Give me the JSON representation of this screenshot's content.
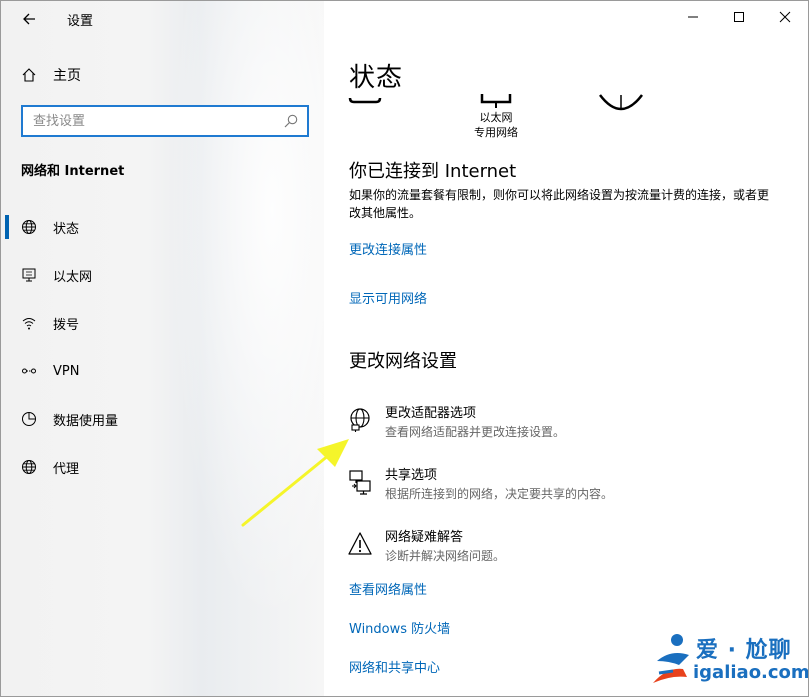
{
  "window": {
    "title": "设置"
  },
  "sidebar": {
    "home_label": "主页",
    "search_placeholder": "查找设置",
    "section_title": "网络和 Internet",
    "items": [
      {
        "label": "状态",
        "icon": "globe-icon",
        "active": true
      },
      {
        "label": "以太网",
        "icon": "ethernet-icon"
      },
      {
        "label": "拨号",
        "icon": "dialup-icon"
      },
      {
        "label": "VPN",
        "icon": "vpn-icon"
      },
      {
        "label": "数据使用量",
        "icon": "data-usage-icon"
      },
      {
        "label": "代理",
        "icon": "globe-icon"
      }
    ]
  },
  "main": {
    "title": "状态",
    "diagram": {
      "network_name": "以太网",
      "network_type": "专用网络"
    },
    "connected_heading": "你已连接到 Internet",
    "connected_text": "如果你的流量套餐有限制，则你可以将此网络设置为按流量计费的连接，或者更改其他属性。",
    "link_change_props": "更改连接属性",
    "link_show_networks": "显示可用网络",
    "change_heading": "更改网络设置",
    "options": [
      {
        "title": "更改适配器选项",
        "desc": "查看网络适配器并更改连接设置。",
        "icon": "adapter-globe-icon"
      },
      {
        "title": "共享选项",
        "desc": "根据所连接到的网络，决定要共享的内容。",
        "icon": "sharing-icon"
      },
      {
        "title": "网络疑难解答",
        "desc": "诊断并解决网络问题。",
        "icon": "warning-icon"
      }
    ],
    "link_view_props": "查看网络属性",
    "link_firewall": "Windows 防火墙",
    "link_sharing_center": "网络和共享中心"
  },
  "watermark": {
    "text": "爱 · 尬聊",
    "url": "igaliao.com"
  },
  "colors": {
    "accent": "#0063b1",
    "link": "#0067b8",
    "arrow": "#f5f52a",
    "watermark": "#1a6fbf"
  }
}
